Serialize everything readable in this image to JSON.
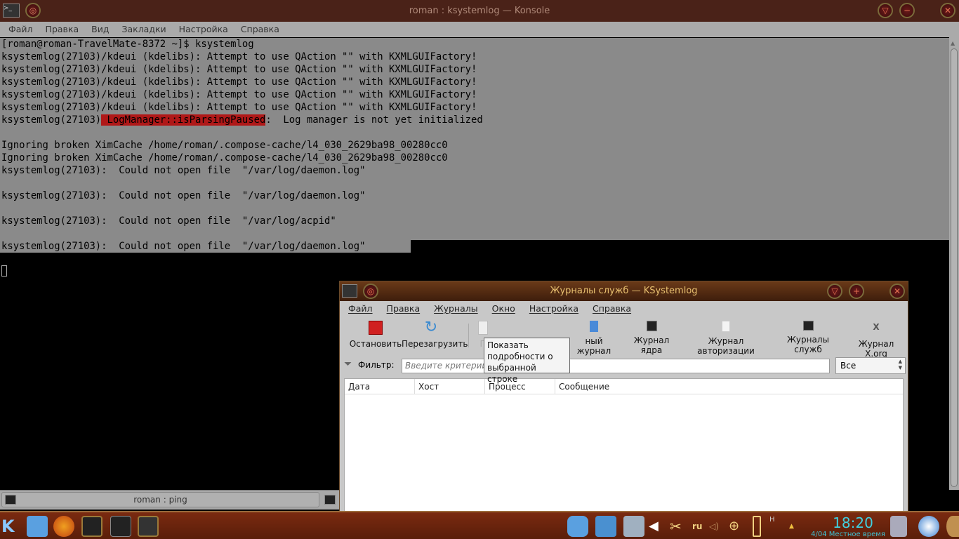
{
  "konsole": {
    "title": "roman : ksystemlog — Konsole",
    "menu": [
      "Файл",
      "Правка",
      "Вид",
      "Закладки",
      "Настройка",
      "Справка"
    ],
    "lines": [
      "[roman@roman-TravelMate-8372 ~]$ ksystemlog",
      "ksystemlog(27103)/kdeui (kdelibs): Attempt to use QAction \"\" with KXMLGUIFactory!",
      "ksystemlog(27103)/kdeui (kdelibs): Attempt to use QAction \"\" with KXMLGUIFactory!",
      "ksystemlog(27103)/kdeui (kdelibs): Attempt to use QAction \"\" with KXMLGUIFactory!",
      "ksystemlog(27103)/kdeui (kdelibs): Attempt to use QAction \"\" with KXMLGUIFactory!",
      "ksystemlog(27103)/kdeui (kdelibs): Attempt to use QAction \"\" with KXMLGUIFactory!"
    ],
    "warn_prefix": "ksystemlog(27103)",
    "warn_highlight": " LogManager::isParsingPaused",
    "warn_suffix": ":  Log manager is not yet initialized",
    "lines2": [
      "",
      "Ignoring broken XimCache /home/roman/.compose-cache/l4_030_2629ba98_00280cc0",
      "Ignoring broken XimCache /home/roman/.compose-cache/l4_030_2629ba98_00280cc0",
      "ksystemlog(27103):  Could not open file  \"/var/log/daemon.log\"",
      "",
      "ksystemlog(27103):  Could not open file  \"/var/log/daemon.log\"",
      "",
      "ksystemlog(27103):  Could not open file  \"/var/log/acpid\"",
      "",
      "ksystemlog(27103):  Could not open file  \"/var/log/daemon.log\""
    ],
    "tab": "roman : ping"
  },
  "ksystemlog": {
    "title": "Журналы служб — KSystemlog",
    "menu": [
      "Файл",
      "Правка",
      "Журналы",
      "Окно",
      "Настройка",
      "Справка"
    ],
    "toolbar": {
      "stop": "Остановить",
      "reload": "Перезагрузить",
      "details": "П",
      "system": "ный журнал",
      "kernel": "Журнал ядра",
      "auth": "Журнал авторизации",
      "daemons": "Журналы служб",
      "xorg": "Журнал X.org"
    },
    "filter_label": "Фильтр:",
    "filter_placeholder": "Введите критерии поиска",
    "filter_select": "Все",
    "columns": [
      "Дата",
      "Хост",
      "Процесс",
      "Сообщение"
    ],
    "tooltip": "Показать подробности о выбранной строке"
  },
  "taskbar": {
    "lang": "ru",
    "time": "18:20",
    "date": "4/04 Местное время"
  }
}
